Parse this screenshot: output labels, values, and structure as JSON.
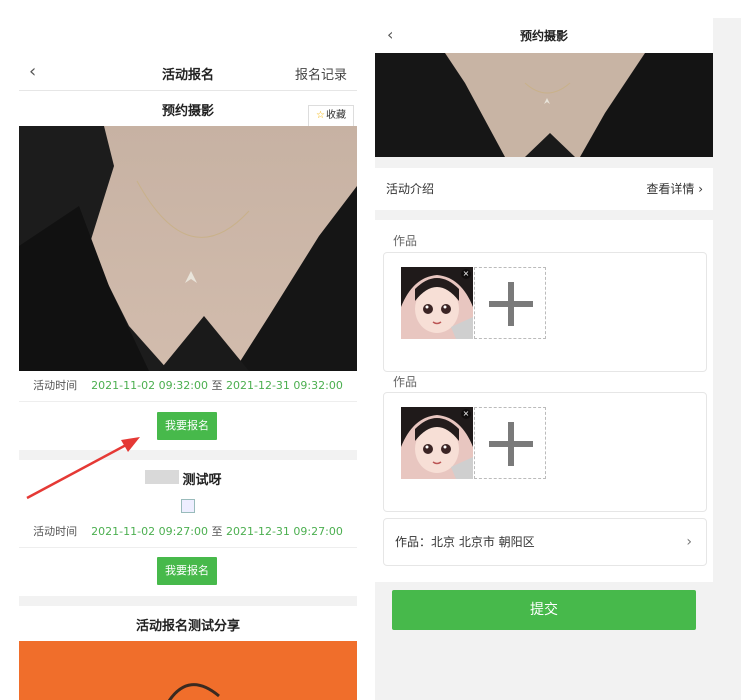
{
  "left": {
    "nav": {
      "back": "‹",
      "title": "活动报名",
      "right": "报名记录"
    },
    "event1": {
      "title": "预约摄影",
      "favorite": {
        "star": "☆",
        "label": "收藏"
      },
      "time_label": "活动时间",
      "start": "2021-11-02 09:32:00",
      "to": "至",
      "end": "2021-12-31 09:32:00",
      "button": "我要报名"
    },
    "event2": {
      "title": "测试呀",
      "time_label": "活动时间",
      "start": "2021-11-02 09:27:00",
      "to": "至",
      "end": "2021-12-31 09:27:00",
      "button": "我要报名"
    },
    "share_title": "活动报名测试分享"
  },
  "right": {
    "nav": {
      "back": "‹",
      "title": "预约摄影"
    },
    "intro": {
      "label": "活动介绍",
      "link": "查看详情 ›"
    },
    "works": [
      {
        "label": "作品",
        "delete_icon": "×"
      },
      {
        "label": "作品",
        "delete_icon": "×"
      }
    ],
    "location": {
      "text": "作品：北京 北京市 朝阳区",
      "chevron": "›"
    },
    "submit": "提交"
  },
  "colors": {
    "accent_green": "#47b94b",
    "time_green": "#4caf50",
    "banner_orange": "#f06e2b",
    "arrow_red": "#e53935"
  }
}
